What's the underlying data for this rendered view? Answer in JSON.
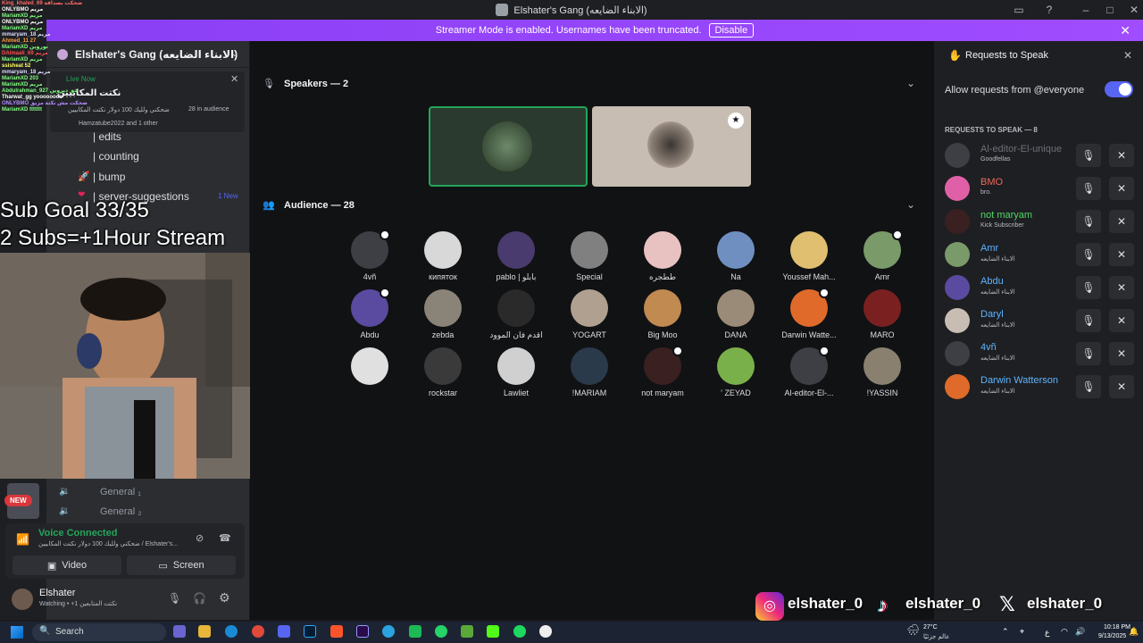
{
  "window": {
    "title": "Elshater's Gang (الابناء الضايعه)"
  },
  "banner": {
    "text": "Streamer Mode is enabled. Usernames have been truncated.",
    "disable": "Disable"
  },
  "server": {
    "name": "Elshater's Gang (الابناء الضايعه)",
    "live": {
      "badge": "Live Now",
      "title": "نكتت المكابيين",
      "desc": "ضحكني ولليك 100 دولار نكتت المكابيين",
      "audience": "28 in audience",
      "speakers": "Hamzatube2022 and 1 other"
    },
    "channels": [
      "| edits",
      "| counting",
      "| bump",
      "| server-suggestions"
    ],
    "new_badge": "1 New",
    "voice_channels": [
      "General ₁",
      "General ₂"
    ],
    "new_pill": "NEW"
  },
  "voice": {
    "status": "Voice Connected",
    "detail": "ضحكني ولليك 100 دولار نكتت المكابيين / Elshater's...",
    "video": "Video",
    "screen": "Screen"
  },
  "user": {
    "name": "Elshater",
    "status": "Watching • +1 نكتت المتابعين"
  },
  "overlay": {
    "subgoal_line1": "Sub Goal 33/35",
    "subgoal_line2": "2 Subs=+1Hour Stream",
    "chat": [
      "King_khaled_69 ضحكت بصداقة",
      "ONLYBMO مريم",
      "MariamXD مريم",
      "ONLYBMO مريم",
      "MariamXD مريم",
      "mmaryam_18 مريم",
      "Ahmed_11 27",
      "MariamXD نوروين",
      "DAlmaali_69 مريم",
      "MariamXD مريم",
      "ssisheat 52",
      "mmaryam_18 مريم",
      "MariamXD 203",
      "MariamXD مريم",
      "Abdulrahman_927 حق ديروين",
      "Tharwat_gg yoooooooo",
      "ONLYBMO ضحكت مش نكتة مزيق",
      "MariamXD ttttttt"
    ],
    "socials": [
      "elshater_0",
      "elshater_0",
      "elshater_0"
    ]
  },
  "stage": {
    "speakers_header": "Speakers — 2",
    "audience_header": "Audience — 28",
    "audience": [
      "4vñ",
      "кипяток",
      "pablo | بابلو",
      "Special",
      "ططجره",
      "Na",
      "Youssef Mah...",
      "Amr",
      "Abdu",
      "zebda",
      "اقدم فان الموود",
      "YOGART",
      "Big Moo",
      "DANA",
      "Darwin Watte...",
      "MARO",
      "",
      "rockstar",
      "Lawliet",
      "!MARIAM",
      "not maryam",
      "' ZEYAD",
      "Al-editor-El-...",
      "!YASSIN"
    ]
  },
  "requests": {
    "title": "Requests to Speak",
    "allow": "Allow requests from @everyone",
    "section": "REQUESTS TO SPEAK — 8",
    "items": [
      {
        "name": "Al-editor-El-unique",
        "sub": "Goodfellas",
        "color": "#6d6f78"
      },
      {
        "name": "BMO",
        "sub": "bro.",
        "color": "#f0675a"
      },
      {
        "name": "not maryam",
        "sub": "Kick Subscriber",
        "color": "#4dd964"
      },
      {
        "name": "Amr",
        "sub": "الابناء الضايعه",
        "color": "#5fb3ff"
      },
      {
        "name": "Abdu",
        "sub": "الابناء الضايعه",
        "color": "#5fb3ff"
      },
      {
        "name": "Daryl",
        "sub": "الابناء الضايعه",
        "color": "#5fb3ff"
      },
      {
        "name": "4vñ",
        "sub": "الابناء الضايعه",
        "color": "#5fb3ff"
      },
      {
        "name": "Darwin Watterson",
        "sub": "الابناء الضايعه",
        "color": "#5fb3ff"
      }
    ]
  },
  "taskbar": {
    "search": "Search",
    "weather": "27°C",
    "weather_sub": "عالم جزئيًا",
    "lang": "ع",
    "time": "10:18 PM",
    "date": "9/13/2025"
  }
}
